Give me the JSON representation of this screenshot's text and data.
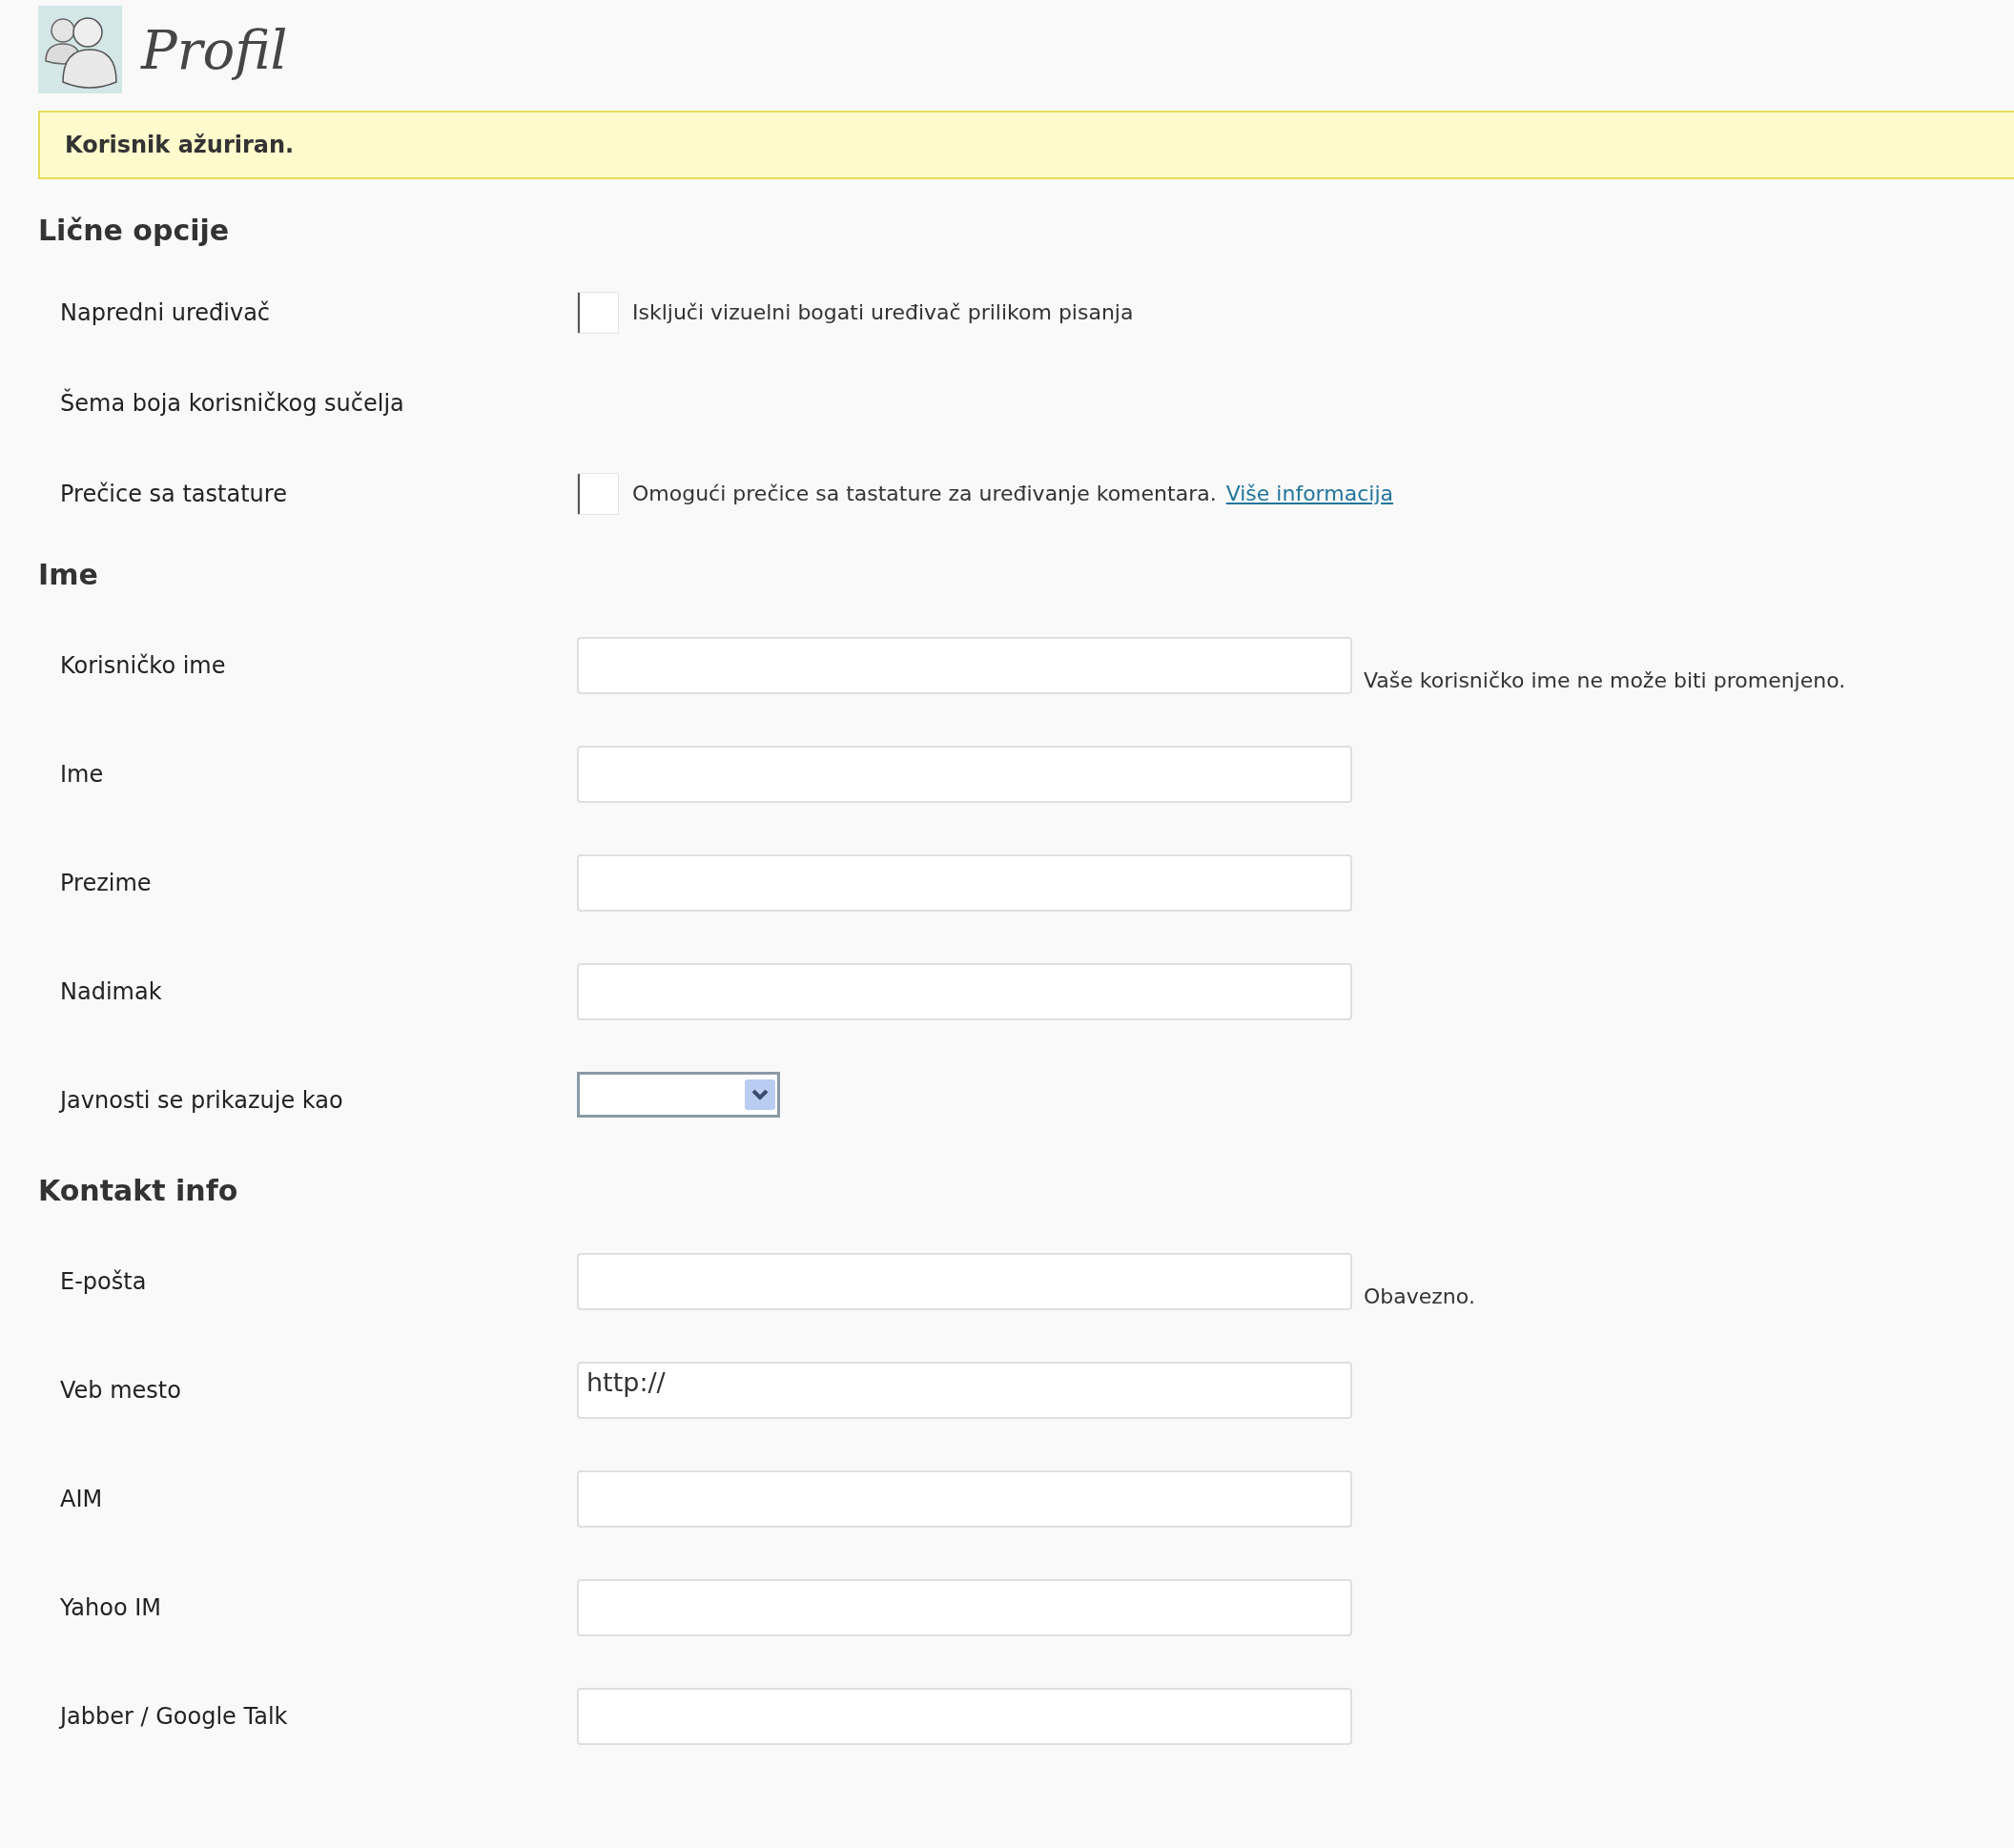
{
  "title": "Profil",
  "notice": "Korisnik ažuriran.",
  "sections": [
    {
      "heading": "Lične opcije",
      "rows": [
        {
          "kind": "checkbox",
          "label": "Napredni uređivač",
          "checked": false,
          "text": "Isključi vizuelni bogati uređivač prilikom pisanja"
        },
        {
          "kind": "empty",
          "label": "Šema boja korisničkog sučelja"
        },
        {
          "kind": "checkbox",
          "label": "Prečice sa tastature",
          "checked": false,
          "text": "Omogući prečice sa tastature za uređivanje komentara.",
          "link": "Više informacija"
        }
      ]
    },
    {
      "heading": "Ime",
      "rows": [
        {
          "kind": "text",
          "label": "Korisničko ime",
          "note": "Vaše korisničko ime ne može biti promenjeno."
        },
        {
          "kind": "text",
          "label": "Ime"
        },
        {
          "kind": "text",
          "label": "Prezime"
        },
        {
          "kind": "text",
          "label": "Nadimak"
        },
        {
          "kind": "select",
          "label": "Javnosti se prikazuje kao"
        }
      ]
    },
    {
      "heading": "Kontakt info",
      "rows": [
        {
          "kind": "text",
          "label": "E-pošta",
          "note": "Obavezno."
        },
        {
          "kind": "text",
          "label": "Veb mesto",
          "value": "http://"
        },
        {
          "kind": "text",
          "label": "AIM"
        },
        {
          "kind": "text",
          "label": "Yahoo IM"
        },
        {
          "kind": "text",
          "label": "Jabber / Google Talk"
        }
      ]
    }
  ]
}
